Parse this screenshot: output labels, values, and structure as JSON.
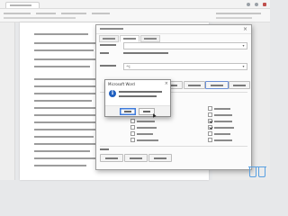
{
  "word_window": {
    "tabs": [
      "document-tab"
    ],
    "window_controls": [
      "minimize-icon",
      "maximize-icon",
      "close-icon"
    ]
  },
  "find_replace_dialog": {
    "close_glyph": "×",
    "tabs": [
      "find-tab",
      "replace-tab"
    ],
    "active_tab": "replace-tab",
    "find_field_value": "",
    "replace_field_value": "^l",
    "dropdown_glyph": "▾"
  },
  "message_box": {
    "title": "Microsoft Word",
    "close_glyph": "×",
    "icon_glyph": "i",
    "icon_name": "info-icon",
    "default_button": "ok-button"
  },
  "colors": {
    "accent": "#1f5fbf",
    "watermark": "#5aa0e0"
  }
}
